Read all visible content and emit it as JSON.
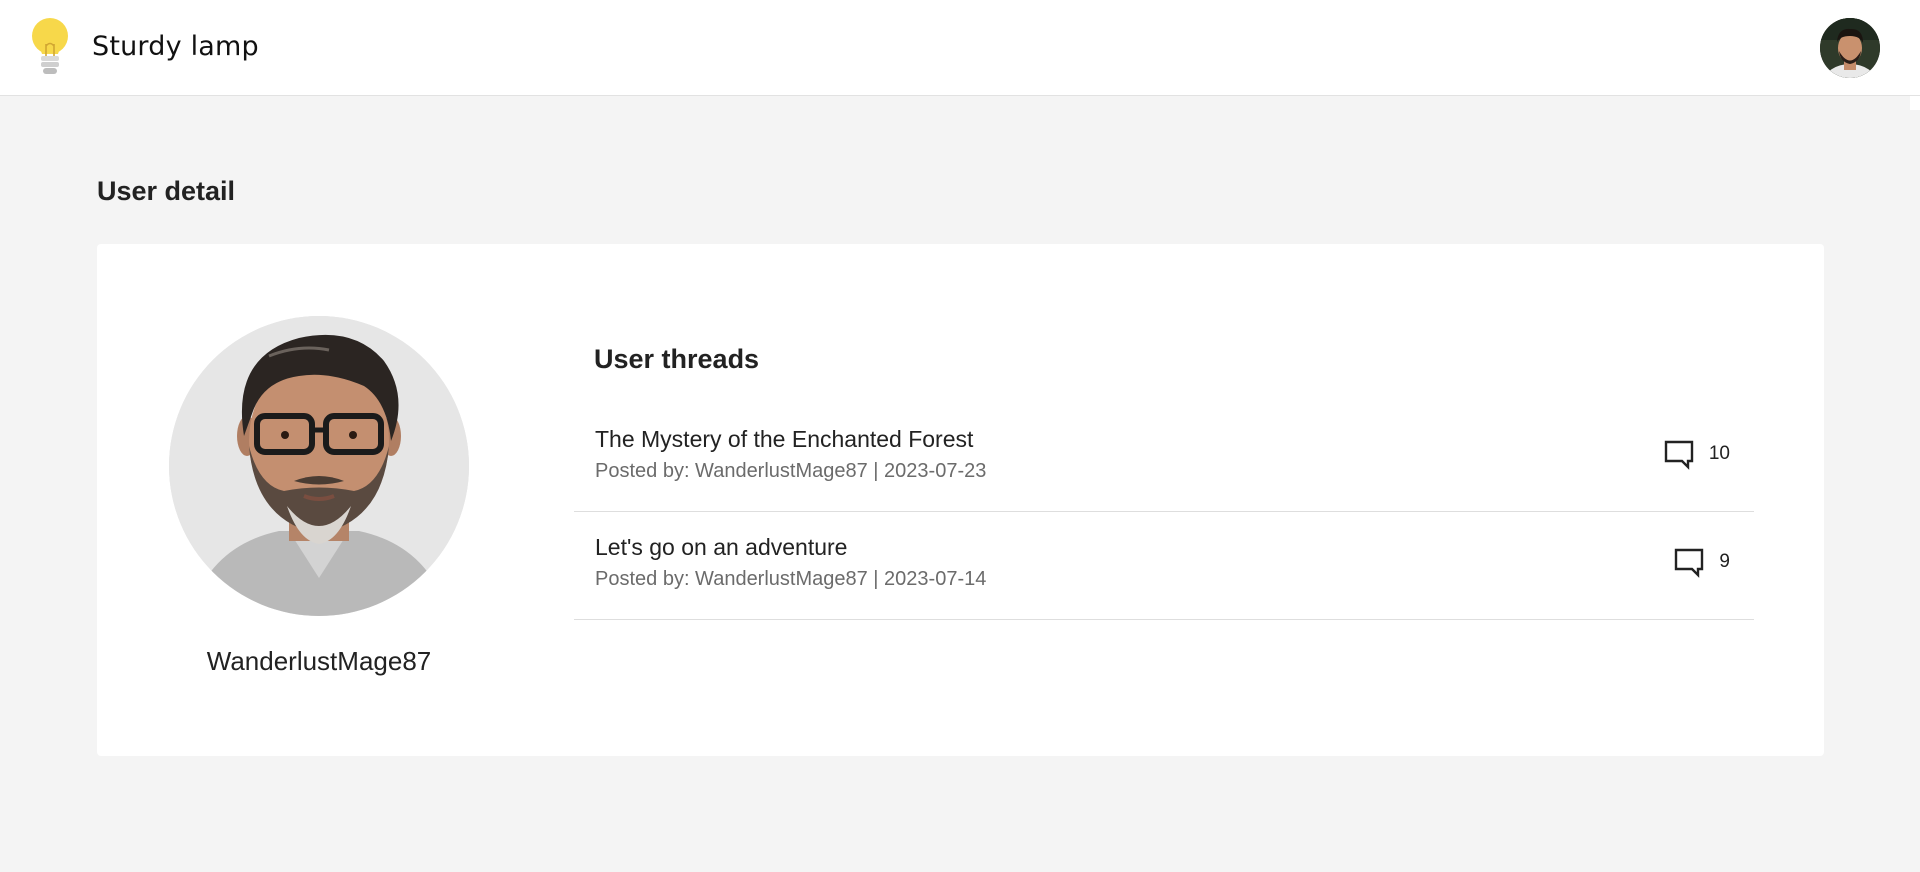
{
  "header": {
    "brand_name": "Sturdy lamp",
    "logo_icon": "lightbulb-icon",
    "user_avatar": "avatar"
  },
  "page": {
    "title": "User detail"
  },
  "profile": {
    "username": "WanderlustMage87"
  },
  "threads": {
    "title": "User threads",
    "items": [
      {
        "title": "The Mystery of the Enchanted Forest",
        "meta": "Posted by: WanderlustMage87 | 2023-07-23",
        "comments": "10"
      },
      {
        "title": "Let's go on an adventure",
        "meta": "Posted by: WanderlustMage87 | 2023-07-14",
        "comments": "9"
      }
    ]
  },
  "colors": {
    "background": "#f4f4f4",
    "card": "#ffffff",
    "bulb": "#f7d84a",
    "text": "#222222",
    "muted_text": "#6b6b6b"
  }
}
